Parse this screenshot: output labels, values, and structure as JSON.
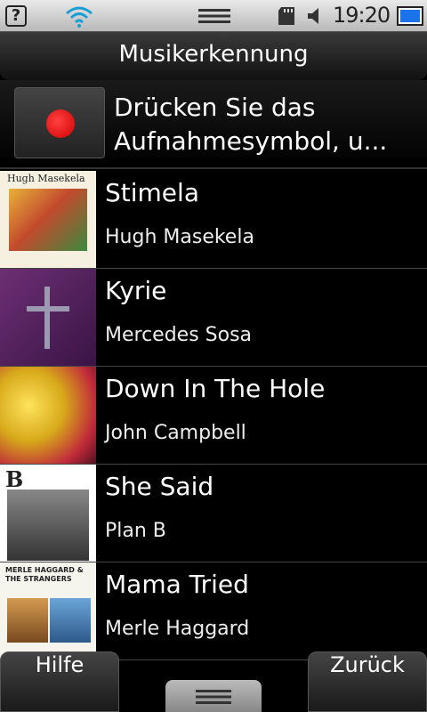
{
  "status_bar": {
    "time": "19:20",
    "icons": [
      "help-icon",
      "wifi-icon",
      "drag-handle-icon",
      "sd-card-icon",
      "volume-icon",
      "battery-icon"
    ],
    "help_glyph": "?"
  },
  "header": {
    "title": "Musikerkennung"
  },
  "record_panel": {
    "instruction": "Drücken Sie das Aufnahmesymbol, u...",
    "record_color": "#e00000"
  },
  "songs": [
    {
      "title": "Stimela",
      "artist": "Hugh Masekela",
      "art_caption": "Hugh Masekela"
    },
    {
      "title": "Kyrie",
      "artist": "Mercedes Sosa"
    },
    {
      "title": "Down In The Hole",
      "artist": "John Campbell"
    },
    {
      "title": "She Said",
      "artist": "Plan B",
      "art_caption": "B"
    },
    {
      "title": "Mama Tried",
      "artist": "Merle Haggard",
      "art_caption": "MERLE HAGGARD & THE STRANGERS"
    }
  ],
  "footer": {
    "help_label": "Hilfe",
    "back_label": "Zurück"
  },
  "colors": {
    "accent_battery": "#1a73e8",
    "background": "#000000"
  }
}
